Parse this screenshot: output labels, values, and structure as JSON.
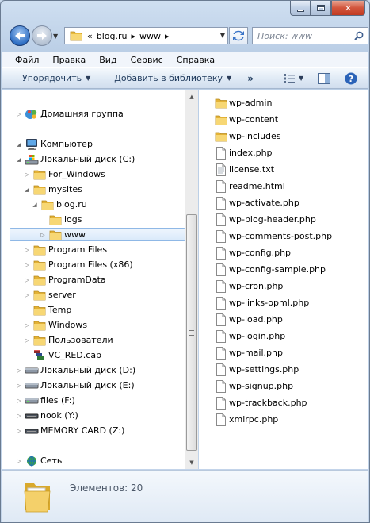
{
  "window": {
    "caption_buttons": {
      "minimize": "minimize",
      "maximize": "maximize",
      "close": "✕"
    }
  },
  "navbar": {
    "address": {
      "prefix": "«",
      "segments": [
        "blog.ru",
        "www"
      ],
      "separator": "▸"
    },
    "search_placeholder": "Поиск: www"
  },
  "menu": [
    "Файл",
    "Правка",
    "Вид",
    "Сервис",
    "Справка"
  ],
  "commands": {
    "organize": "Упорядочить",
    "add_to_library": "Добавить в библиотеку",
    "more": "»"
  },
  "tree": [
    {
      "label": "Домашняя группа",
      "icon": "homegroup-icon",
      "depth": 0,
      "expander": "▷"
    },
    {
      "label": "Компьютер",
      "icon": "computer-icon",
      "depth": 0,
      "expander": "◢"
    },
    {
      "label": "Локальный диск (C:)",
      "icon": "drive-c-icon",
      "depth": 1,
      "expander": "◢"
    },
    {
      "label": "For_Windows",
      "icon": "folder-icon",
      "depth": 2,
      "expander": "▷"
    },
    {
      "label": "mysites",
      "icon": "folder-icon",
      "depth": 2,
      "expander": "◢"
    },
    {
      "label": "blog.ru",
      "icon": "folder-icon",
      "depth": 3,
      "expander": "◢"
    },
    {
      "label": "logs",
      "icon": "folder-icon",
      "depth": 4,
      "expander": ""
    },
    {
      "label": "www",
      "icon": "folder-icon",
      "depth": 4,
      "expander": "▷",
      "selected": true
    },
    {
      "label": "Program Files",
      "icon": "folder-icon",
      "depth": 2,
      "expander": "▷"
    },
    {
      "label": "Program Files (x86)",
      "icon": "folder-icon",
      "depth": 2,
      "expander": "▷"
    },
    {
      "label": "ProgramData",
      "icon": "folder-icon",
      "depth": 2,
      "expander": "▷"
    },
    {
      "label": "server",
      "icon": "folder-icon",
      "depth": 2,
      "expander": "▷"
    },
    {
      "label": "Temp",
      "icon": "folder-icon",
      "depth": 2,
      "expander": ""
    },
    {
      "label": "Windows",
      "icon": "folder-icon",
      "depth": 2,
      "expander": "▷"
    },
    {
      "label": "Пользователи",
      "icon": "folder-icon",
      "depth": 2,
      "expander": "▷"
    },
    {
      "label": "VC_RED.cab",
      "icon": "cab-archive-icon",
      "depth": 2,
      "expander": ""
    },
    {
      "label": "Локальный диск (D:)",
      "icon": "drive-icon",
      "depth": 1,
      "expander": "▷"
    },
    {
      "label": "Локальный диск (E:)",
      "icon": "drive-icon",
      "depth": 1,
      "expander": "▷"
    },
    {
      "label": "files (F:)",
      "icon": "drive-icon",
      "depth": 1,
      "expander": "▷"
    },
    {
      "label": "nook (Y:)",
      "icon": "removable-drive-icon",
      "depth": 1,
      "expander": "▷"
    },
    {
      "label": "MEMORY CARD (Z:)",
      "icon": "removable-drive-icon",
      "depth": 1,
      "expander": "▷"
    },
    {
      "label": "Сеть",
      "icon": "network-icon",
      "depth": 0,
      "expander": "▷"
    }
  ],
  "files": [
    {
      "name": "wp-admin",
      "type": "folder"
    },
    {
      "name": "wp-content",
      "type": "folder"
    },
    {
      "name": "wp-includes",
      "type": "folder"
    },
    {
      "name": "index.php",
      "type": "file"
    },
    {
      "name": "license.txt",
      "type": "text"
    },
    {
      "name": "readme.html",
      "type": "file"
    },
    {
      "name": "wp-activate.php",
      "type": "file"
    },
    {
      "name": "wp-blog-header.php",
      "type": "file"
    },
    {
      "name": "wp-comments-post.php",
      "type": "file"
    },
    {
      "name": "wp-config.php",
      "type": "file"
    },
    {
      "name": "wp-config-sample.php",
      "type": "file"
    },
    {
      "name": "wp-cron.php",
      "type": "file"
    },
    {
      "name": "wp-links-opml.php",
      "type": "file"
    },
    {
      "name": "wp-load.php",
      "type": "file"
    },
    {
      "name": "wp-login.php",
      "type": "file"
    },
    {
      "name": "wp-mail.php",
      "type": "file"
    },
    {
      "name": "wp-settings.php",
      "type": "file"
    },
    {
      "name": "wp-signup.php",
      "type": "file"
    },
    {
      "name": "wp-trackback.php",
      "type": "file"
    },
    {
      "name": "xmlrpc.php",
      "type": "file"
    }
  ],
  "details": {
    "item_count": "Элементов: 20"
  },
  "colors": {
    "accent": "#2f6fc4",
    "folder": "#f0c84a",
    "selection": "#d9e9fa"
  }
}
